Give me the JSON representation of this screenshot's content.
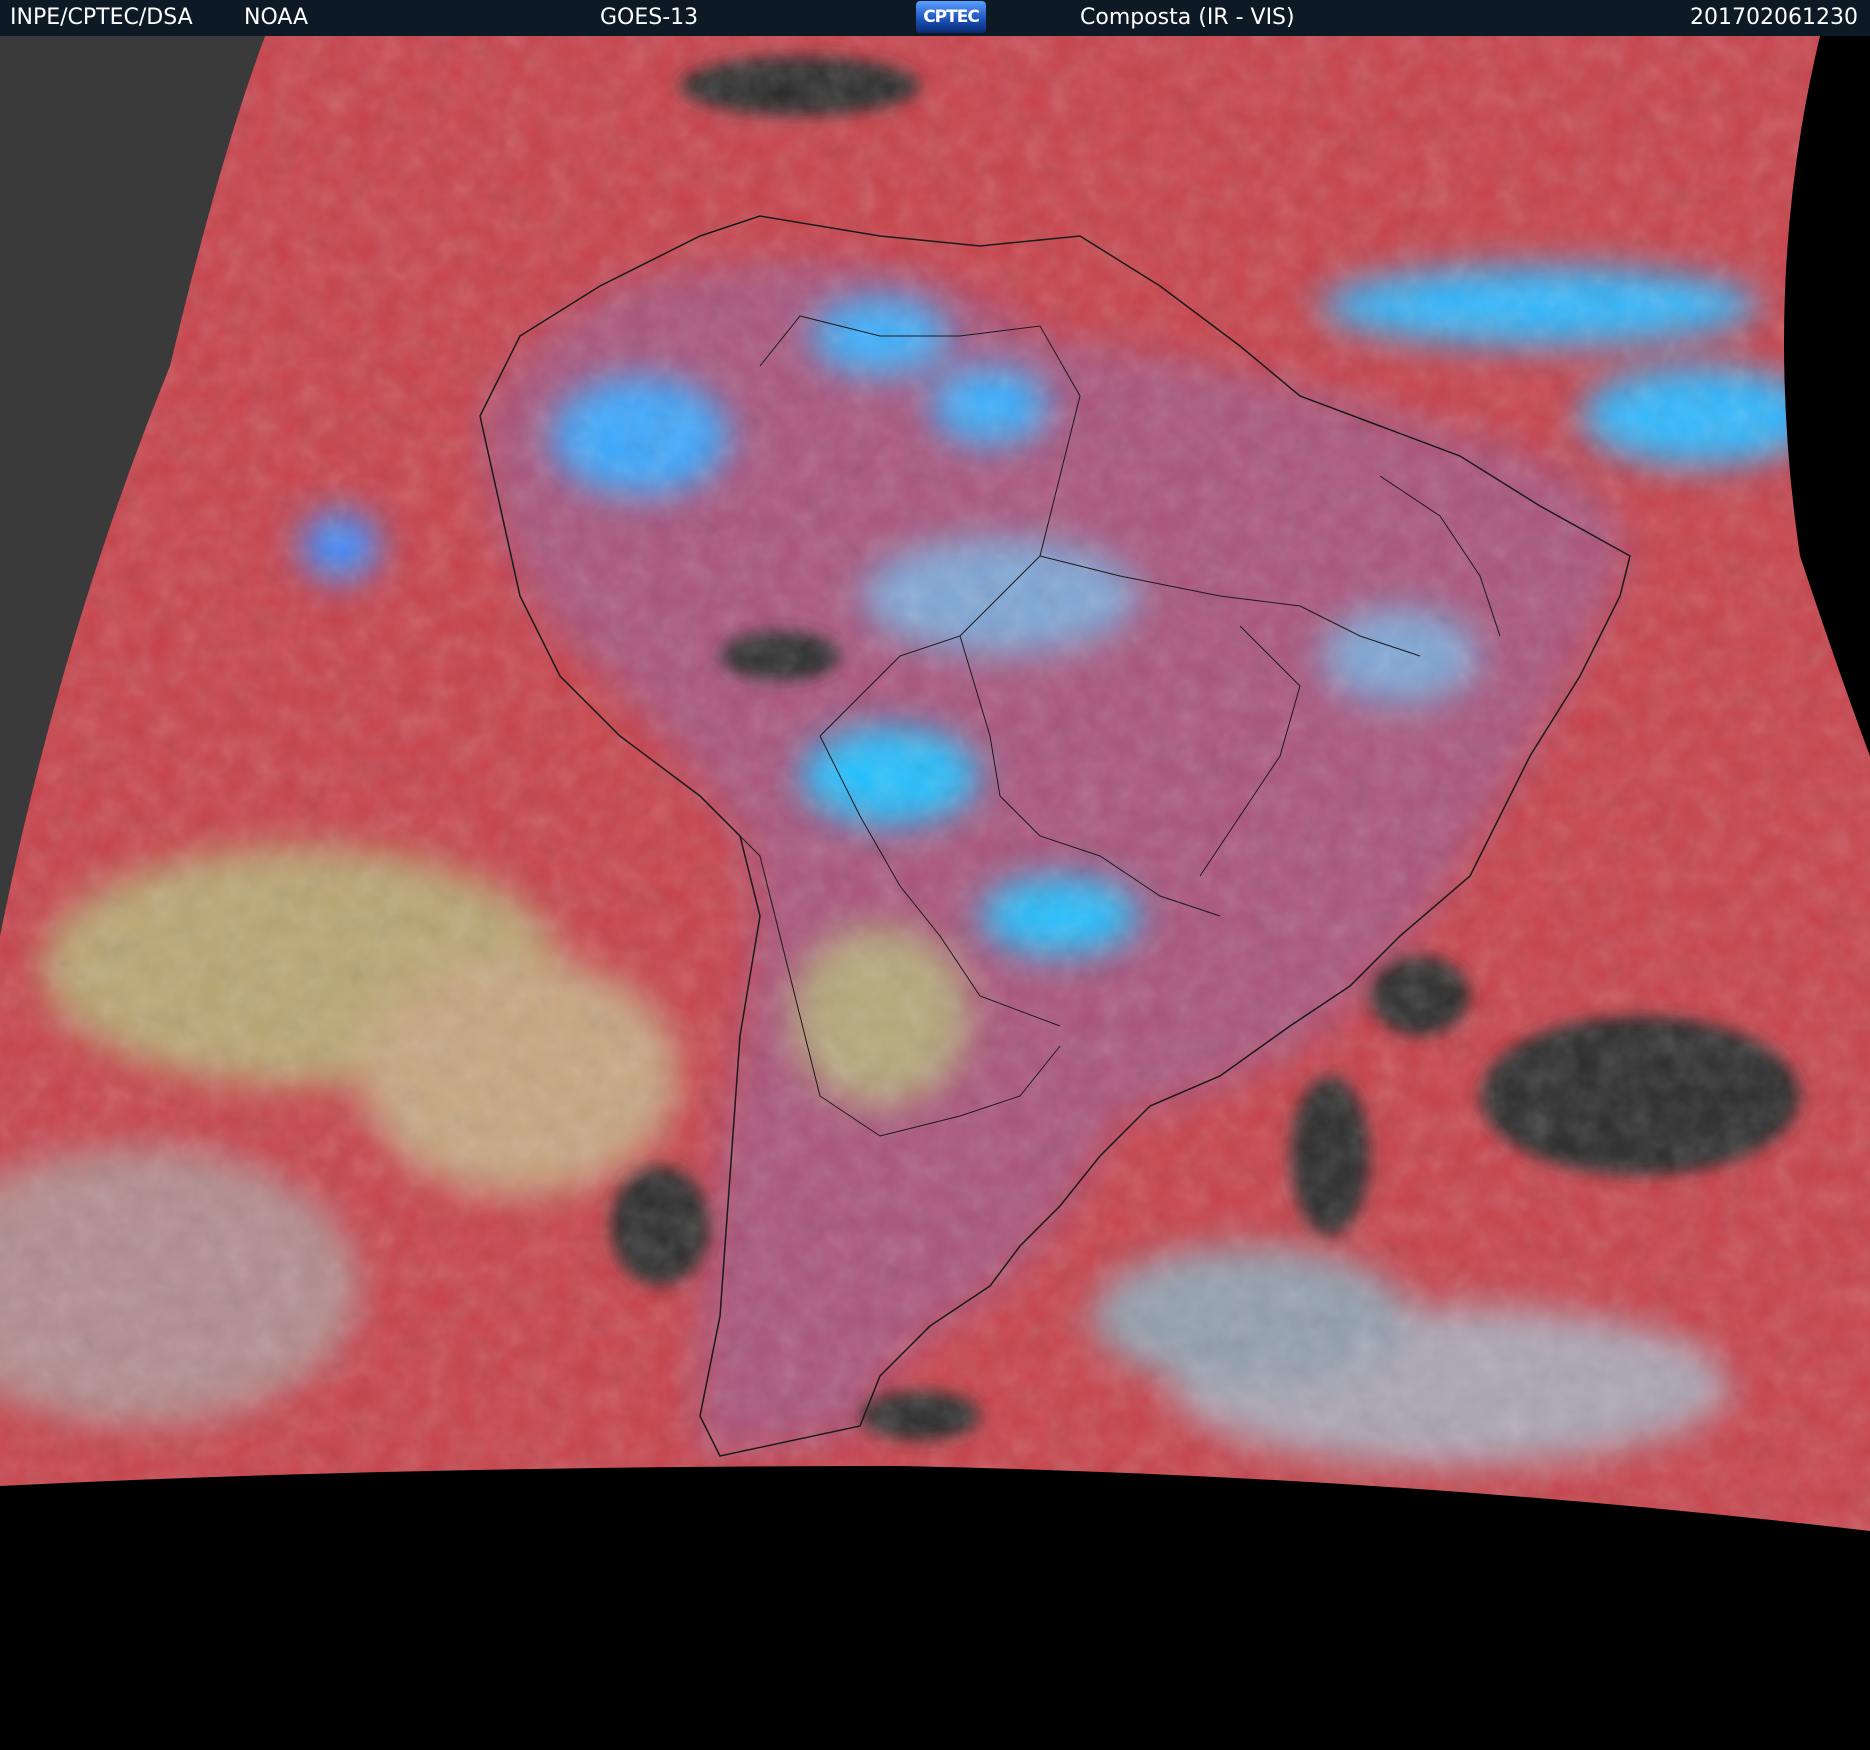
{
  "header": {
    "source": "INPE/CPTEC/DSA",
    "agency": "NOAA",
    "satellite": "GOES-13",
    "logo_text": "CPTEC",
    "product": "Composta (IR - VIS)",
    "timestamp": "201702061230"
  },
  "colors": {
    "header_bg": "#0d1a26",
    "ocean_red": "#c8414a",
    "cloud_cyan": "#2fb8ff",
    "cloud_blue": "#4a86e8",
    "cloud_yellow": "#b7b87a",
    "land_magenta": "#a05a8c",
    "clear_dark": "#2a2a2a",
    "space_gray": "#3c3c3c",
    "background": "#000000"
  },
  "icons": {
    "logo": "cptec-logo"
  }
}
